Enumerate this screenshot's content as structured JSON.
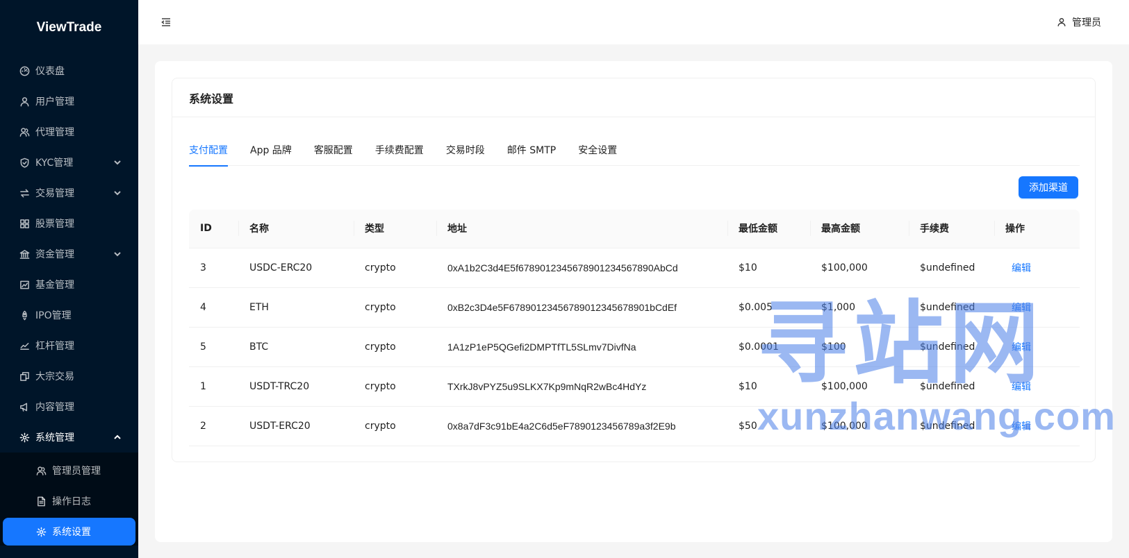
{
  "app": {
    "logo": "ViewTrade"
  },
  "sidebar": {
    "items": [
      {
        "label": "仪表盘",
        "icon": "dashboard-icon"
      },
      {
        "label": "用户管理",
        "icon": "user-icon"
      },
      {
        "label": "代理管理",
        "icon": "team-icon"
      },
      {
        "label": "KYC管理",
        "icon": "shield-icon",
        "has_children": true
      },
      {
        "label": "交易管理",
        "icon": "swap-icon",
        "has_children": true
      },
      {
        "label": "股票管理",
        "icon": "appstore-icon"
      },
      {
        "label": "资金管理",
        "icon": "bank-icon",
        "has_children": true
      },
      {
        "label": "基金管理",
        "icon": "fund-icon"
      },
      {
        "label": "IPO管理",
        "icon": "rocket-icon"
      },
      {
        "label": "杠杆管理",
        "icon": "stock-icon"
      },
      {
        "label": "大宗交易",
        "icon": "block-icon"
      },
      {
        "label": "内容管理",
        "icon": "notification-icon"
      },
      {
        "label": "系统管理",
        "icon": "gear-icon",
        "open": true
      }
    ],
    "subitems": [
      {
        "label": "管理员管理",
        "icon": "team-icon"
      },
      {
        "label": "操作日志",
        "icon": "file-icon"
      },
      {
        "label": "系统设置",
        "icon": "gear-icon",
        "active": true
      }
    ]
  },
  "header": {
    "user_name": "管理员"
  },
  "page": {
    "title": "系统设置",
    "tabs": [
      "支付配置",
      "App 品牌",
      "客服配置",
      "手续费配置",
      "交易时段",
      "邮件 SMTP",
      "安全设置"
    ],
    "active_tab": 0,
    "add_button": "添加渠道",
    "table": {
      "columns": [
        "ID",
        "名称",
        "类型",
        "地址",
        "最低金额",
        "最高金额",
        "手续费",
        "操作"
      ],
      "rows": [
        {
          "id": "3",
          "name": "USDC-ERC20",
          "type": "crypto",
          "address": "0xA1b2C3d4E5f67890123456789012345678 90AbCd",
          "min": "$10",
          "max": "$100,000",
          "fee": "$undefined",
          "action": "编辑"
        },
        {
          "id": "4",
          "name": "ETH",
          "type": "crypto",
          "address": "0xB2c3D4e5F67890123456789012345678901bCdEf",
          "min": "$0.005",
          "max": "$1,000",
          "fee": "$undefined",
          "action": "编辑"
        },
        {
          "id": "5",
          "name": "BTC",
          "type": "crypto",
          "address": "1A1zP1eP5QGefi2DMPTfTL5SLmv7DivfNa",
          "min": "$0.0001",
          "max": "$100",
          "fee": "$undefined",
          "action": "编辑"
        },
        {
          "id": "1",
          "name": "USDT-TRC20",
          "type": "crypto",
          "address": "TXrkJ8vPYZ5u9SLKX7Kp9mNqR2wBc4HdYz",
          "min": "$10",
          "max": "$100,000",
          "fee": "$undefined",
          "action": "编辑"
        },
        {
          "id": "2",
          "name": "USDT-ERC20",
          "type": "crypto",
          "address": "0x8a7dF3c91bE4a2C6d5eF7890123456789a3f2E9b",
          "min": "$50",
          "max": "$100,000",
          "fee": "$undefined",
          "action": "编辑"
        }
      ]
    }
  },
  "watermark": {
    "cn": "寻站网",
    "en": "xunzhanwang.com"
  },
  "colors": {
    "primary": "#1677ff",
    "sider_bg": "#001529",
    "submenu_bg": "#000c17"
  }
}
